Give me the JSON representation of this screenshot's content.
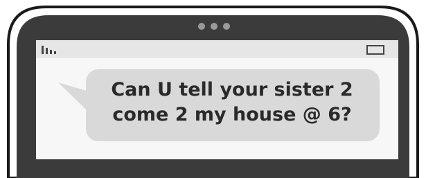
{
  "colors": {
    "phone_body": "#3b3b3b",
    "phone_outline": "#1a1a1a",
    "screen_background": "#f7f7f7",
    "status_bar": "#e6e6e6",
    "bubble": "#d9d9d9",
    "text": "#2a2a2a"
  },
  "icons": {
    "signal": "signal-bars-icon",
    "battery": "battery-icon",
    "speaker": "speaker-dots-icon"
  },
  "message": {
    "line1": "Can U tell your sister 2",
    "line2": "come 2 my house @ 6?"
  }
}
